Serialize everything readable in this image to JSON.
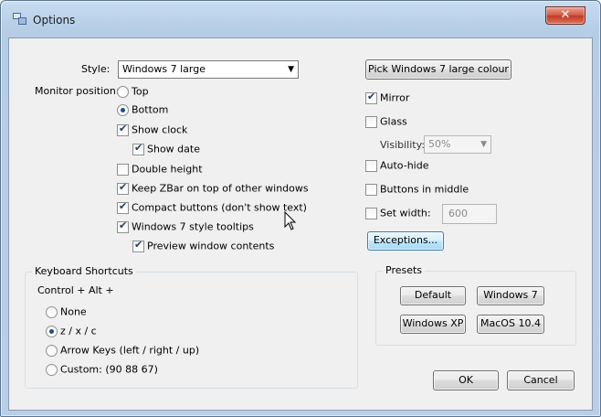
{
  "window": {
    "title": "Options",
    "close_glyph": "✕"
  },
  "left": {
    "style_label": "Style:",
    "style_value": "Windows 7 large",
    "monitor_label": "Monitor position:",
    "pos_top": "Top",
    "pos_bottom": "Bottom",
    "show_clock": "Show clock",
    "show_date": "Show date",
    "double_height": "Double height",
    "keep_on_top": "Keep ZBar on top of other windows",
    "compact": "Compact buttons (don't show text)",
    "tooltips": "Windows 7 style tooltips",
    "preview": "Preview window contents"
  },
  "right": {
    "pick_colour": "Pick Windows 7 large colour",
    "mirror": "Mirror",
    "glass": "Glass",
    "visibility_label": "Visibility:",
    "visibility_value": "50%",
    "auto_hide": "Auto-hide",
    "buttons_middle": "Buttons in middle",
    "set_width": "Set width:",
    "width_value": "600",
    "exceptions": "Exceptions..."
  },
  "shortcuts": {
    "title": "Keyboard Shortcuts",
    "modifier": "Control + Alt +",
    "none": "None",
    "zxc": "z / x / c",
    "arrows": "Arrow Keys (left / right / up)",
    "custom": "Custom: (90 88 67)"
  },
  "presets": {
    "title": "Presets",
    "default": "Default",
    "win7": "Windows 7",
    "winxp": "Windows XP",
    "macos": "MacOS 10.4"
  },
  "footer": {
    "ok": "OK",
    "cancel": "Cancel"
  },
  "state": {
    "position": "Bottom",
    "show_clock": true,
    "show_date": true,
    "double_height": false,
    "keep_on_top": true,
    "compact": true,
    "tooltips": true,
    "preview": true,
    "mirror": true,
    "glass": false,
    "auto_hide": false,
    "buttons_middle": false,
    "set_width": false,
    "shortcut": "z / x / c"
  },
  "colors": {
    "titlebar": "#c7dcf0",
    "client_bg": "#f0f0f0",
    "close_button": "#c13b24",
    "focus_button": "#bee6fd"
  }
}
